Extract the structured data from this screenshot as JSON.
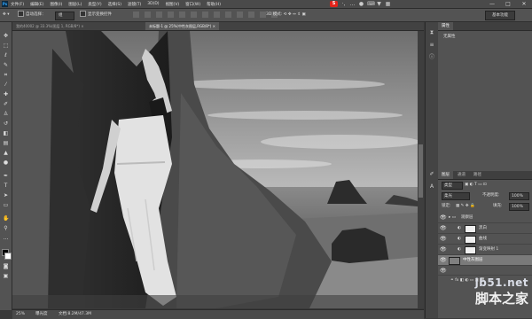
{
  "menubar": {
    "app_icon": "Ps",
    "items": [
      "文件(F)",
      "编辑(E)",
      "图像(I)",
      "图层(L)",
      "类型(Y)",
      "选择(S)",
      "滤镜(T)",
      "3D(D)",
      "视图(V)",
      "窗口(W)",
      "帮助(H)"
    ],
    "tray_icons": [
      "sogou-s-logo",
      "punctuation-icon",
      "ellipsis-icon",
      "mic-icon",
      "keyboard-icon",
      "shirt-icon",
      "grid-icon"
    ],
    "window_buttons": [
      "—",
      "□",
      "✕"
    ]
  },
  "options": {
    "auto_select_label": "自动选择：",
    "auto_select_value": "组",
    "show_transform_label": "显示变换控件",
    "workspace": "基本功能"
  },
  "tabs": [
    {
      "label": "我的40002 @ 33.3%(图层 1, RGB/8*) ×",
      "active": false
    },
    {
      "label": "未标题-1 @ 25%(中性灰图层,RGB/8*) ×",
      "active": true
    }
  ],
  "status": {
    "zoom": "25%",
    "doc_label": "曝光度",
    "doc_size": "文档:8.2M/47.3M"
  },
  "panels": {
    "properties": {
      "tabs": [
        "属性"
      ],
      "label": "无属性"
    },
    "layers": {
      "tabs": [
        "图层",
        "通道",
        "路径"
      ],
      "kind_filter": "类型",
      "blend_mode": "柔光",
      "opacity_label": "不透明度:",
      "opacity": "100%",
      "lock_label": "锁定:",
      "fill_label": "填充:",
      "fill": "100%",
      "rows": [
        {
          "name": "观察层",
          "type": "group",
          "selected": false
        },
        {
          "name": "黑白",
          "type": "adjustment",
          "selected": false
        },
        {
          "name": "曲线",
          "type": "adjustment",
          "selected": false
        },
        {
          "name": "渐变映射 1",
          "type": "adjustment",
          "selected": false
        },
        {
          "name": "中性灰图层",
          "type": "layer",
          "selected": true
        }
      ]
    }
  },
  "watermark": {
    "line1": "jb51.net",
    "line2": "脚本之家"
  }
}
